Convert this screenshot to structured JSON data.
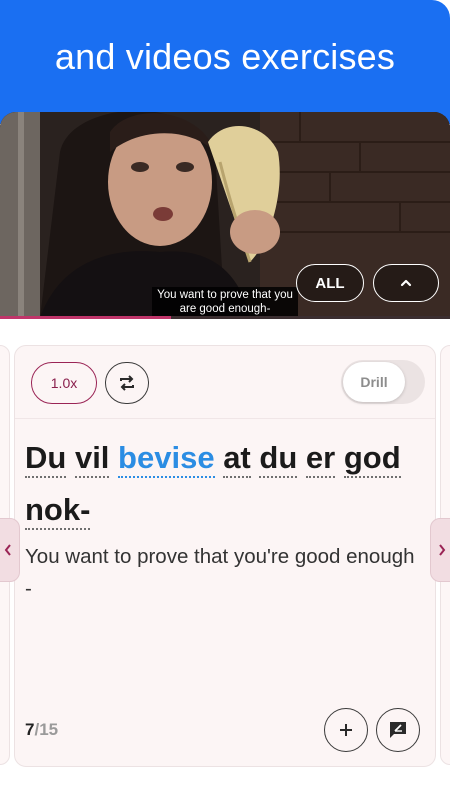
{
  "header": {
    "title": "and videos exercises"
  },
  "video": {
    "subtitle": "You want to prove that you are good enough-",
    "all_label": "ALL",
    "progress": 0.38
  },
  "card": {
    "speed_label": "1.0x",
    "drill_label": "Drill",
    "sentence_words": [
      "Du",
      "vil",
      "bevise",
      "at",
      "du",
      "er",
      "god",
      "nok-"
    ],
    "highlighted_word": "bevise",
    "translation": "You want to prove that you're good enough -",
    "counter_current": "7",
    "counter_total": "/15"
  },
  "icons": {
    "repeat": "repeat-icon",
    "chevron_up": "chevron-up-icon",
    "add": "plus-icon",
    "feedback": "feedback-icon",
    "prev": "chevron-left-icon",
    "next": "chevron-right-icon"
  },
  "colors": {
    "brand_blue": "#1a6ff2",
    "accent": "#9a2455",
    "highlight": "#2b8de3"
  }
}
